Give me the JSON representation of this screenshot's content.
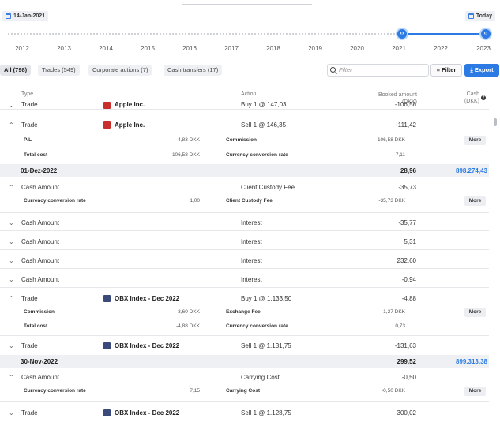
{
  "header": {
    "start_date": "14-Jan-2021",
    "today_label": "Today",
    "years": [
      "2012",
      "2013",
      "2014",
      "2015",
      "2016",
      "2017",
      "2018",
      "2019",
      "2020",
      "2021",
      "2022",
      "2023"
    ]
  },
  "tabs": [
    {
      "label": "All (798)"
    },
    {
      "label": "Trades (549)"
    },
    {
      "label": "Corporate actions (7)"
    },
    {
      "label": "Cash transfers (17)"
    }
  ],
  "search": {
    "placeholder": "Filter"
  },
  "buttons": {
    "filter": "Filter",
    "export": "Export",
    "more": "More"
  },
  "columns": {
    "type": "Type",
    "action": "Action",
    "booked": "Booked amount\n(DKK)",
    "cash": "Cash\n(DKK)"
  },
  "rows": {
    "r0": {
      "type": "Trade",
      "instrument": "Apple Inc.",
      "action": "Buy 1 @ 147,03",
      "amount": "-106,58"
    },
    "r1": {
      "type": "Trade",
      "instrument": "Apple Inc.",
      "action": "Sell 1 @ 146,35",
      "amount": "-111,42"
    },
    "r1d": {
      "l1": "P/L",
      "v1": "-4,83 DKK",
      "l2": "Commission",
      "v2": "-106,58 DKK",
      "l3": "Total cost",
      "v3": "-106,58 DKK",
      "l4": "Currency conversion rate",
      "v4": "7,11"
    },
    "g1": {
      "date": "01-Dez-2022",
      "amount": "28,96",
      "cash": "898.274,43"
    },
    "r2": {
      "type": "Cash Amount",
      "action": "Client Custody Fee",
      "amount": "-35,73"
    },
    "r2d": {
      "l1": "Currency conversion rate",
      "v1": "1,00",
      "l2": "Client Custody Fee",
      "v2": "-35,73 DKK"
    },
    "r3": {
      "type": "Cash Amount",
      "action": "Interest",
      "amount": "-35,77"
    },
    "r4": {
      "type": "Cash Amount",
      "action": "Interest",
      "amount": "5,31"
    },
    "r5": {
      "type": "Cash Amount",
      "action": "Interest",
      "amount": "232,60"
    },
    "r6": {
      "type": "Cash Amount",
      "action": "Interest",
      "amount": "-0,94"
    },
    "r7": {
      "type": "Trade",
      "instrument": "OBX Index - Dec 2022",
      "action": "Buy 1 @ 1.133,50",
      "amount": "-4,88"
    },
    "r7d": {
      "l1": "Commission",
      "v1": "-3,60 DKK",
      "l2": "Exchange Fee",
      "v2": "-1,27 DKK",
      "l3": "Total cost",
      "v3": "-4,88 DKK",
      "l4": "Currency conversion rate",
      "v4": "0,73"
    },
    "r8": {
      "type": "Trade",
      "instrument": "OBX Index - Dec 2022",
      "action": "Sell 1 @ 1.131,75",
      "amount": "-131,63"
    },
    "g2": {
      "date": "30-Nov-2022",
      "amount": "299,52",
      "cash": "899.313,38"
    },
    "r9": {
      "type": "Cash Amount",
      "action": "Carrying Cost",
      "amount": "-0,50"
    },
    "r9d": {
      "l1": "Currency conversion rate",
      "v1": "7,15",
      "l2": "Carrying Cost",
      "v2": "-0,50 DKK"
    },
    "r10": {
      "type": "Trade",
      "instrument": "OBX Index - Dec 2022",
      "action": "Sell 1 @ 1.128,75",
      "amount": "300,02"
    }
  }
}
